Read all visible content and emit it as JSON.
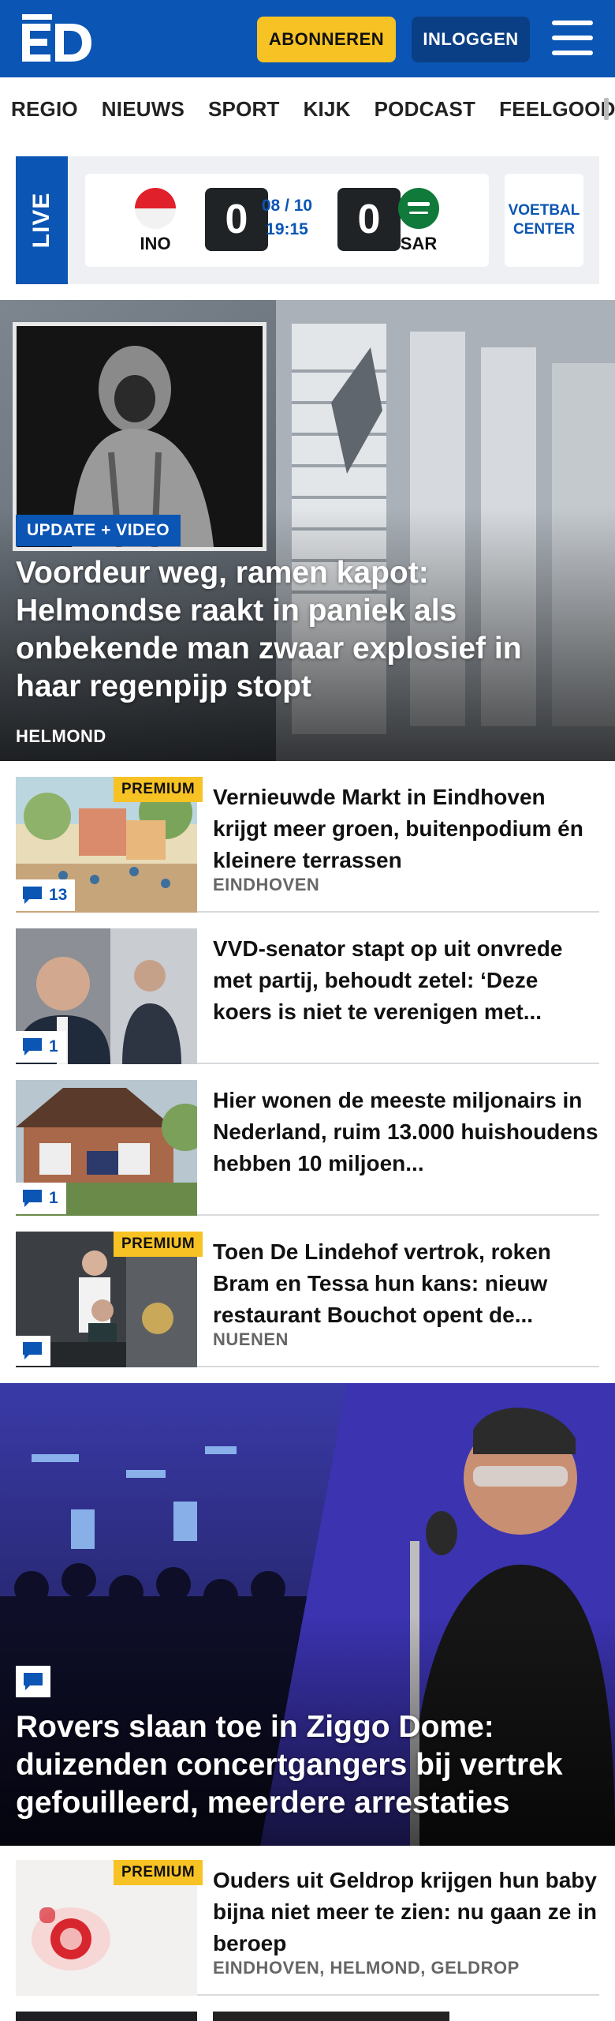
{
  "header": {
    "logo_text": "ED",
    "subscribe_label": "ABONNEREN",
    "login_label": "INLOGGEN",
    "menu_icon": "hamburger-menu-icon",
    "brand_color": "#0b55b4",
    "accent_color": "#f7c223"
  },
  "nav": {
    "items": [
      "REGIO",
      "NIEUWS",
      "SPORT",
      "KIJK",
      "PODCAST",
      "FEELGOOD"
    ]
  },
  "live": {
    "label": "LIVE",
    "home": {
      "code": "INO",
      "score": "0",
      "flag": "indonesia-flag"
    },
    "away": {
      "code": "SAR",
      "score": "0",
      "flag": "saudi-arabia-flag"
    },
    "date": "08 / 10",
    "time": "19:15",
    "voetbal_center": "VOETBAL CENTER"
  },
  "hero": {
    "badge": "UPDATE + VIDEO",
    "title": "Voordeur weg, ramen kapot: Helmondse raakt in paniek als onbekende man zwaar explosief in haar regenpijp stopt",
    "location": "HELMOND"
  },
  "articles": [
    {
      "title": "Vernieuwde Markt in Eindhoven krijgt meer groen, buitenpodium én kleinere terrassen",
      "location": "EINDHOVEN",
      "premium": "PREMIUM",
      "comments": "13"
    },
    {
      "title": "VVD-senator stapt op uit onvrede met partij, behoudt zetel: ‘Deze koers is niet te verenigen met...",
      "location": "",
      "premium": "",
      "comments": "1"
    },
    {
      "title": "Hier wonen de meeste miljonairs in Nederland, ruim 13.000 huishoudens hebben 10 miljoen...",
      "location": "",
      "premium": "",
      "comments": "1"
    },
    {
      "title": "Toen De Lindehof vertrok, roken Bram en Tessa hun kans: nieuw restaurant Bouchot opent de...",
      "location": "NUENEN",
      "premium": "PREMIUM",
      "comments": ""
    }
  ],
  "hero2": {
    "title": "Rovers slaan toe in Ziggo Dome: duizenden concertgangers bij vertrek gefouilleerd, meerdere arrestaties"
  },
  "article_after": {
    "title": "Ouders uit Geldrop krijgen hun baby bijna niet meer te zien: nu gaan ze in beroep",
    "location": "EINDHOVEN, HELMOND, GELDROP",
    "premium": "PREMIUM"
  }
}
